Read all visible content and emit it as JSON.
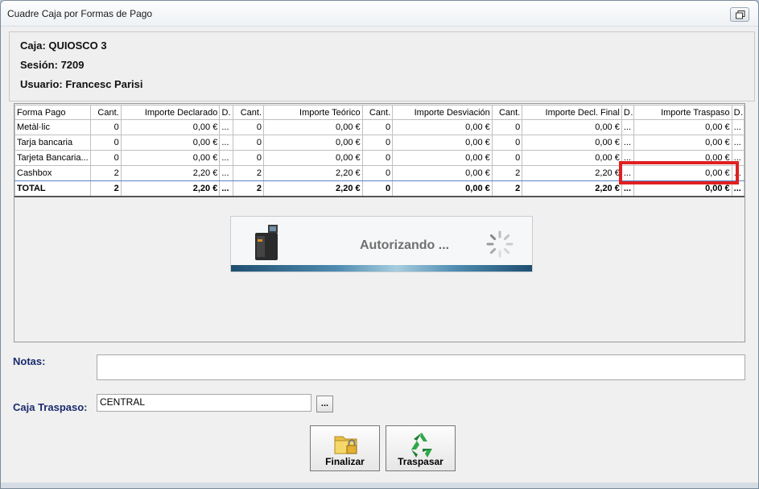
{
  "window": {
    "title": "Cuadre Caja por Formas de Pago"
  },
  "header": {
    "caja": "Caja: QUIOSCO 3",
    "sesion": "Sesión: 7209",
    "usuario": "Usuario: Francesc Parisi"
  },
  "grid": {
    "columns": [
      "Forma Pago",
      "Cant.",
      "Importe Declarado",
      "D.",
      "Cant.",
      "Importe Teórico",
      "Cant.",
      "Importe Desviación",
      "Cant.",
      "Importe Decl. Final",
      "D.",
      "Importe Traspaso",
      "D."
    ],
    "rows": [
      [
        "Metàl·lic",
        "0",
        "0,00 €",
        "...",
        "0",
        "0,00 €",
        "0",
        "0,00 €",
        "0",
        "0,00 €",
        "...",
        "0,00 €",
        "..."
      ],
      [
        "Tarja bancaria",
        "0",
        "0,00 €",
        "...",
        "0",
        "0,00 €",
        "0",
        "0,00 €",
        "0",
        "0,00 €",
        "...",
        "0,00 €",
        "..."
      ],
      [
        "Tarjeta Bancaria...",
        "0",
        "0,00 €",
        "...",
        "0",
        "0,00 €",
        "0",
        "0,00 €",
        "0",
        "0,00 €",
        "...",
        "0,00 €",
        "..."
      ],
      [
        "Cashbox",
        "2",
        "2,20 €",
        "...",
        "2",
        "2,20 €",
        "0",
        "0,00 €",
        "2",
        "2,20 €",
        "...",
        "0,00 €",
        "..."
      ],
      [
        "TOTAL",
        "2",
        "2,20 €",
        "...",
        "2",
        "2,20 €",
        "0",
        "0,00 €",
        "2",
        "2,20 €",
        "...",
        "0,00 €",
        "..."
      ]
    ]
  },
  "auth": {
    "message": "Autorizando ..."
  },
  "notes": {
    "label": "Notas:",
    "value": ""
  },
  "caja_traspaso": {
    "label": "Caja Traspaso:",
    "value": "CENTRAL",
    "browse_label": "..."
  },
  "buttons": {
    "finalizar": "Finalizar",
    "traspasar": "Traspasar"
  },
  "colors": {
    "label_blue": "#1b2b6e",
    "highlight_red": "#e02020",
    "selection_blue": "#5b86c4"
  }
}
